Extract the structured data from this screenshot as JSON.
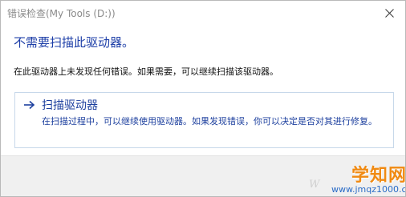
{
  "window": {
    "title": "错误检查(My Tools (D:))"
  },
  "content": {
    "heading": "不需要扫描此驱动器。",
    "description": "在此驱动器上未发现任何错误。如果需要，可以继续扫描该驱动器。",
    "command_link": {
      "title": "扫描驱动器",
      "description": "在扫描过程中，可以继续使用驱动器。如果发现错误，你可以决定是否对其进行修复。"
    }
  },
  "watermark": {
    "logo": "学知网",
    "partial": "W",
    "url": "www.jmqz1000.com"
  },
  "colors": {
    "heading": "#1e3fa8",
    "link": "#1c3f9e",
    "accent_logo": "#f08a12"
  },
  "icons": {
    "close": "close-icon",
    "arrow": "arrow-right-icon"
  }
}
